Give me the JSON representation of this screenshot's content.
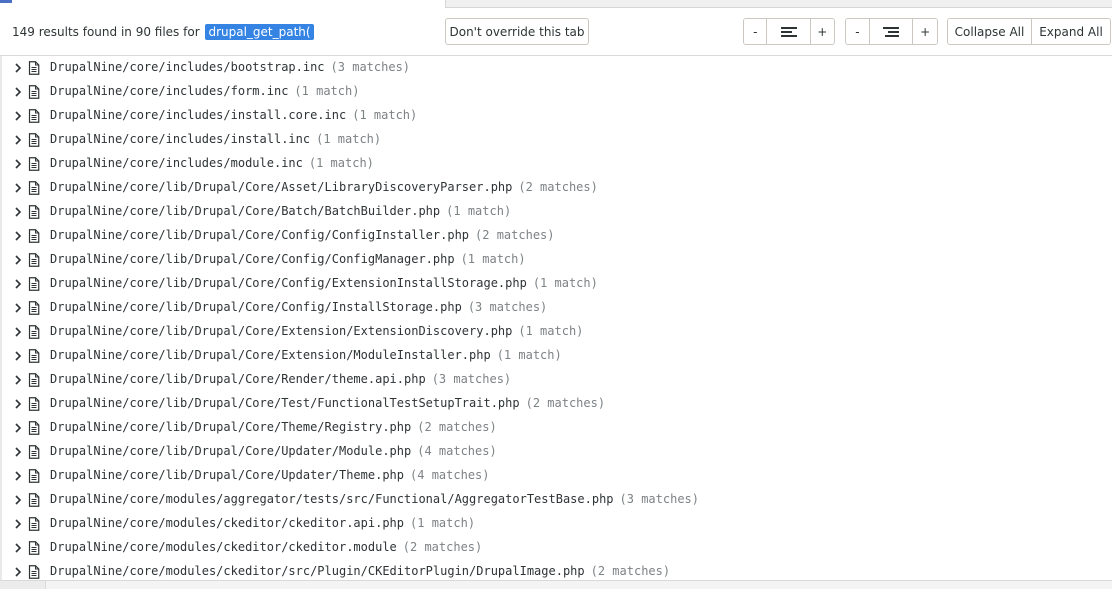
{
  "search": {
    "summary_prefix": "149 results found in 90 files for",
    "query": "drupal_get_path("
  },
  "toolbar": {
    "override_label": "Don't override this tab",
    "minus_label": "-",
    "plus_label": "+",
    "collapse_all_label": "Collapse All",
    "expand_all_label": "Expand All"
  },
  "results": [
    {
      "path": "DrupalNine/core/includes/bootstrap.inc",
      "count": "(3 matches)"
    },
    {
      "path": "DrupalNine/core/includes/form.inc",
      "count": "(1 match)"
    },
    {
      "path": "DrupalNine/core/includes/install.core.inc",
      "count": "(1 match)"
    },
    {
      "path": "DrupalNine/core/includes/install.inc",
      "count": "(1 match)"
    },
    {
      "path": "DrupalNine/core/includes/module.inc",
      "count": "(1 match)"
    },
    {
      "path": "DrupalNine/core/lib/Drupal/Core/Asset/LibraryDiscoveryParser.php",
      "count": "(2 matches)"
    },
    {
      "path": "DrupalNine/core/lib/Drupal/Core/Batch/BatchBuilder.php",
      "count": "(1 match)"
    },
    {
      "path": "DrupalNine/core/lib/Drupal/Core/Config/ConfigInstaller.php",
      "count": "(2 matches)"
    },
    {
      "path": "DrupalNine/core/lib/Drupal/Core/Config/ConfigManager.php",
      "count": "(1 match)"
    },
    {
      "path": "DrupalNine/core/lib/Drupal/Core/Config/ExtensionInstallStorage.php",
      "count": "(1 match)"
    },
    {
      "path": "DrupalNine/core/lib/Drupal/Core/Config/InstallStorage.php",
      "count": "(3 matches)"
    },
    {
      "path": "DrupalNine/core/lib/Drupal/Core/Extension/ExtensionDiscovery.php",
      "count": "(1 match)"
    },
    {
      "path": "DrupalNine/core/lib/Drupal/Core/Extension/ModuleInstaller.php",
      "count": "(1 match)"
    },
    {
      "path": "DrupalNine/core/lib/Drupal/Core/Render/theme.api.php",
      "count": "(3 matches)"
    },
    {
      "path": "DrupalNine/core/lib/Drupal/Core/Test/FunctionalTestSetupTrait.php",
      "count": "(2 matches)"
    },
    {
      "path": "DrupalNine/core/lib/Drupal/Core/Theme/Registry.php",
      "count": "(2 matches)"
    },
    {
      "path": "DrupalNine/core/lib/Drupal/Core/Updater/Module.php",
      "count": "(4 matches)"
    },
    {
      "path": "DrupalNine/core/lib/Drupal/Core/Updater/Theme.php",
      "count": "(4 matches)"
    },
    {
      "path": "DrupalNine/core/modules/aggregator/tests/src/Functional/AggregatorTestBase.php",
      "count": "(3 matches)"
    },
    {
      "path": "DrupalNine/core/modules/ckeditor/ckeditor.api.php",
      "count": "(1 match)"
    },
    {
      "path": "DrupalNine/core/modules/ckeditor/ckeditor.module",
      "count": "(2 matches)"
    },
    {
      "path": "DrupalNine/core/modules/ckeditor/src/Plugin/CKEditorPlugin/DrupalImage.php",
      "count": "(2 matches)"
    }
  ],
  "icons": {
    "row_toggle": "chevron-right-icon",
    "row_file": "file-icon",
    "align_left": "align-left-icon",
    "align_right": "align-right-icon"
  },
  "colors": {
    "query_highlight": "#3584e4",
    "tab_accent": "#4a6fc4",
    "match_count": "#7d8285"
  }
}
